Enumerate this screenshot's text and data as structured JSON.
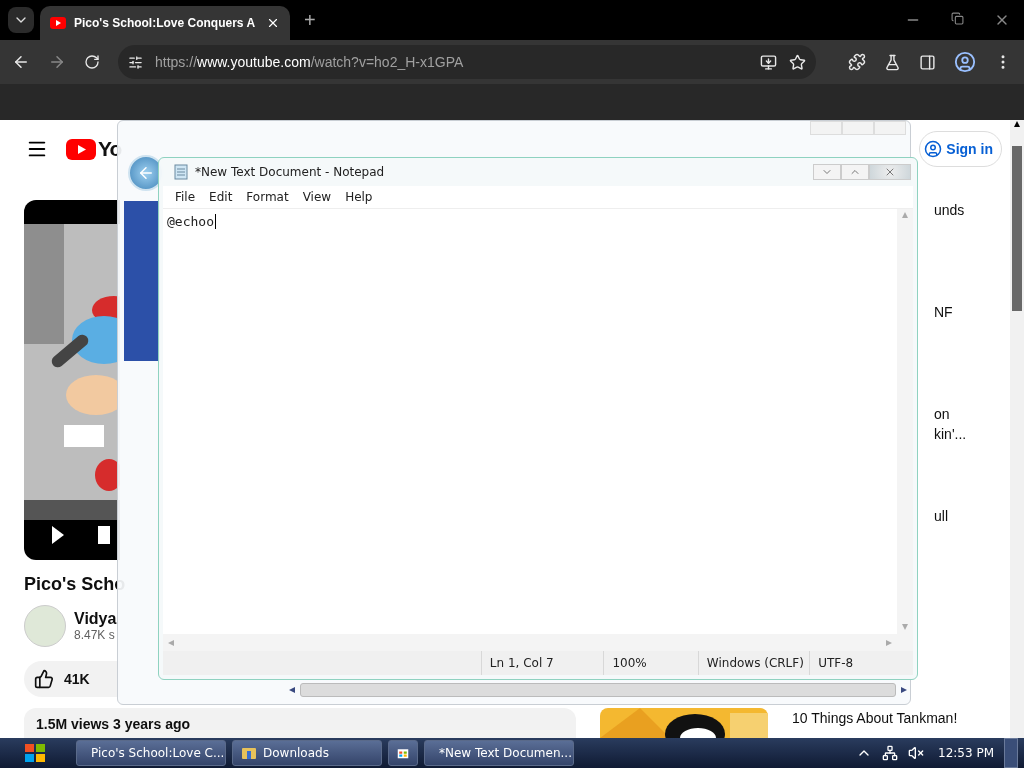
{
  "browser": {
    "tab": {
      "title": "Pico's School:Love Conquers A"
    },
    "new_tab": "+",
    "address": "https://**www.youtube.com**/watch?v=ho2_H-x1GPA"
  },
  "youtube": {
    "logo": "Yo",
    "sign_in": "Sign in",
    "video_title": "Pico's Scho",
    "channel": "Vidya",
    "subscribers": "8.47K s",
    "likes": "41K",
    "description": "1.5M views  3 years ago",
    "sidebar_fragments": [
      [
        "unds"
      ],
      [
        "NF"
      ],
      [
        "on",
        "kin'..."
      ],
      [
        "ull"
      ]
    ],
    "recommended_title": "10 Things About Tankman!"
  },
  "notepad": {
    "title": "*New Text Document - Notepad",
    "menu": [
      "File",
      "Edit",
      "Format",
      "View",
      "Help"
    ],
    "text": "@echoo",
    "status": [
      "Ln 1, Col 7",
      "100%",
      "Windows (CRLF)",
      "UTF-8"
    ]
  },
  "taskbar": {
    "items": [
      {
        "kind": "chrome",
        "label": "Pico's School:Love C..."
      },
      {
        "kind": "folder",
        "label": "Downloads"
      },
      {
        "kind": "store"
      },
      {
        "kind": "notepad",
        "label": "*New Text Documen..."
      }
    ],
    "clock": "12:53 PM"
  }
}
